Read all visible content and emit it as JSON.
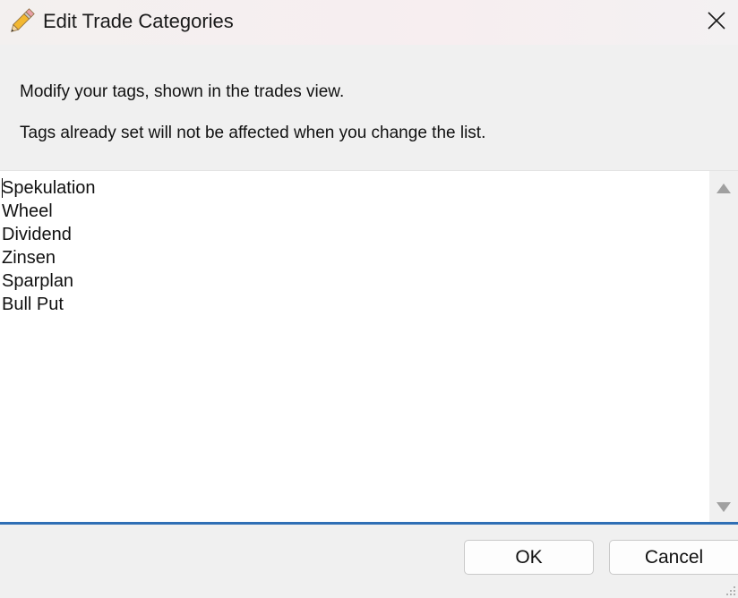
{
  "window": {
    "title": "Edit Trade Categories",
    "icon": "pencil-icon",
    "close_icon": "close-icon"
  },
  "description": {
    "line1": "Modify your tags, shown in the trades view.",
    "line2": "Tags already set will not be affected when you change the list."
  },
  "tags": {
    "items": [
      "Spekulation",
      "Wheel",
      "Dividend",
      "Zinsen",
      "Sparplan",
      "Bull Put"
    ]
  },
  "buttons": {
    "ok_label": "OK",
    "cancel_label": "Cancel"
  },
  "colors": {
    "accent": "#2f6fb5",
    "background": "#f0f0f0"
  }
}
